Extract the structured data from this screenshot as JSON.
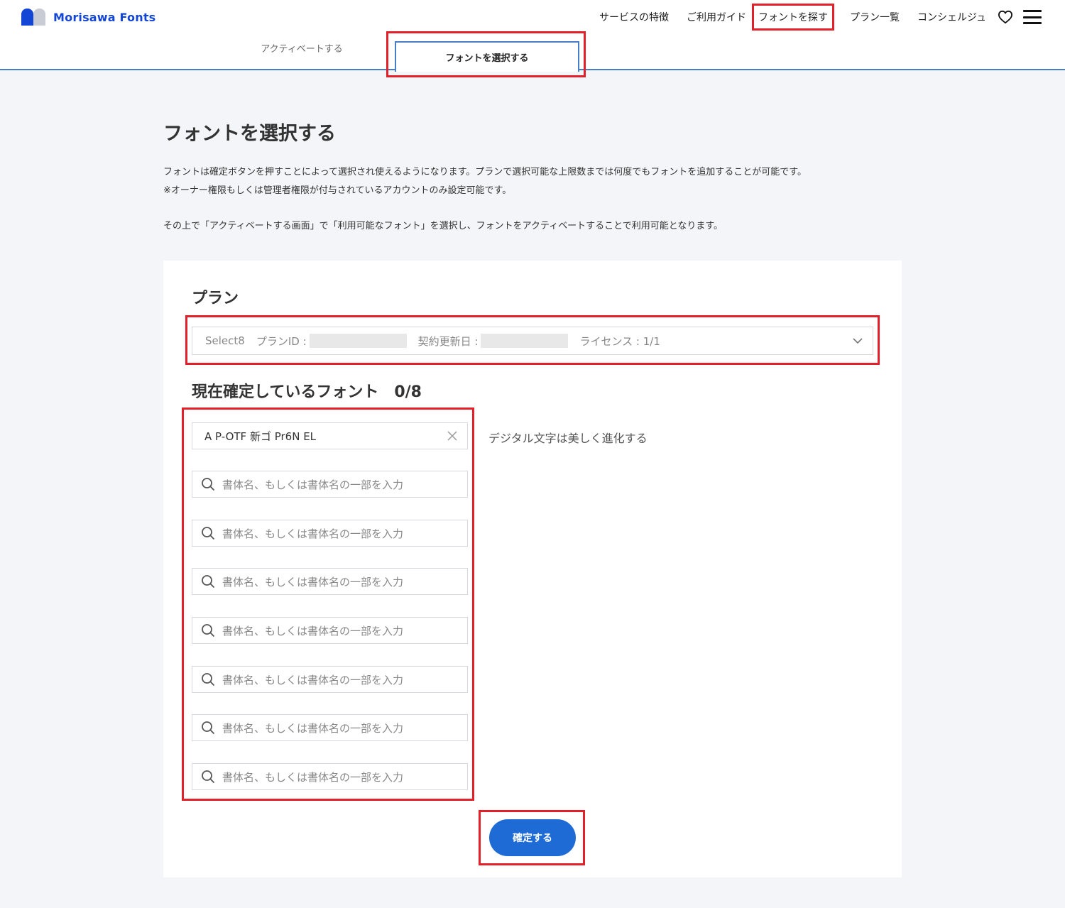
{
  "header": {
    "logo_text": "Morisawa Fonts",
    "nav": [
      {
        "label": "サービスの特徴"
      },
      {
        "label": "ご利用ガイド"
      },
      {
        "label": "フォントを探す"
      },
      {
        "label": "プラン一覧"
      },
      {
        "label": "コンシェルジュ"
      }
    ],
    "icons": [
      "heart-icon",
      "menu-icon"
    ]
  },
  "tabs": {
    "activate": "アクティベートする",
    "select": "フォントを選択する"
  },
  "main": {
    "title": "フォントを選択する",
    "desc1": "フォントは確定ボタンを押すことによって選択され使えるようになります。プランで選択可能な上限数までは何度でもフォントを追加することが可能です。",
    "desc2": "※オーナー権限もしくは管理者権限が付与されているアカウントのみ設定可能です。",
    "desc3": "その上で「アクティベートする画面」で「利用可能なフォント」を選択し、フォントをアクティベートすることで利用可能となります。"
  },
  "plan": {
    "heading": "プラン",
    "name": "Select8",
    "id_label": "プランID :",
    "renewal_label": "契約更新日 :",
    "license": "ライセンス : 1/1"
  },
  "fonts": {
    "heading": "現在確定しているフォント",
    "count": "0/8",
    "selected_font": "A P-OTF 新ゴ Pr6N EL",
    "placeholder": "書体名、もしくは書体名の一部を入力",
    "sample_text": "デジタル文字は美しく進化する"
  },
  "confirm_label": "確定する",
  "colors": {
    "accent": "#1f6bd6",
    "brand": "#1446d6",
    "highlight": "#e3202a"
  }
}
